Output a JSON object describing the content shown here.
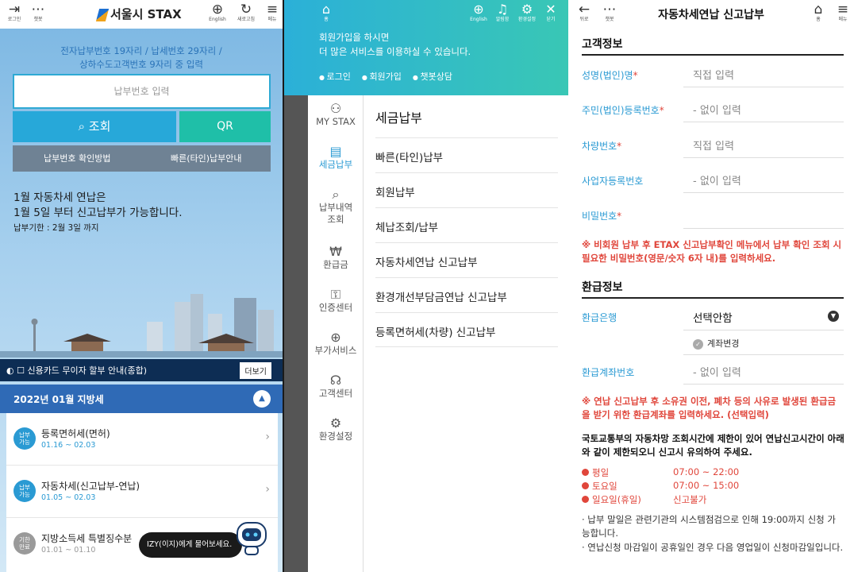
{
  "panel1": {
    "top_icons": [
      {
        "name": "login-icon",
        "glyph": "⇥",
        "label": "로그인"
      },
      {
        "name": "chatbot-icon",
        "glyph": "⋯",
        "label": "챗봇"
      },
      {
        "name": "globe-icon",
        "glyph": "⊕",
        "label": "English"
      },
      {
        "name": "refresh-icon",
        "glyph": "↻",
        "label": "새로고침"
      },
      {
        "name": "menu-icon",
        "glyph": "≡",
        "label": "메뉴"
      }
    ],
    "brand": "서울시 STAX",
    "guide_line1": "전자납부번호 19자리 / 납세번호 29자리 /",
    "guide_line2": "상하수도고객번호 9자리 중 입력",
    "pay_input_placeholder": "납부번호 입력",
    "search_label": "조회",
    "qr_label": "QR",
    "guide_btn1": "납부번호 확인방법",
    "guide_btn2": "빠른(타인)납부안내",
    "notice_line1": "1월 자동차세 연납은",
    "notice_line2": "1월 5일 부터 신고납부가 가능합니다.",
    "notice_sub": "납부기한 : 2월 3일 까지",
    "ticker_text": "◐ ☐ 신용카드 무이자 할부 안내(종합)",
    "more_label": "더보기",
    "month_label": "2022년 01월 지방세",
    "tax_items": [
      {
        "badge": "납부\n가능",
        "name": "등록면허세(면허)",
        "date": "01.16 ~ 02.03",
        "color": "#2a9ad3"
      },
      {
        "badge": "납부\n가능",
        "name": "자동차세(신고납부-연납)",
        "date": "01.05 ~ 02.03",
        "color": "#2a9ad3"
      },
      {
        "badge": "기한\n만료",
        "name": "지방소득세 특별징수분",
        "date": "01.01 ~ 01.10",
        "color": "#9a9a9a"
      }
    ],
    "bot_bubble": "IZY(이지)에게 물어보세요."
  },
  "panel2": {
    "header_icons": [
      {
        "name": "home-icon",
        "glyph": "⌂",
        "label": "홈"
      },
      {
        "name": "globe-icon",
        "glyph": "⊕",
        "label": "English"
      },
      {
        "name": "bell-icon",
        "glyph": "♫",
        "label": "알림함"
      },
      {
        "name": "gear-icon",
        "glyph": "⚙",
        "label": "환경설정"
      },
      {
        "name": "close-icon",
        "glyph": "✕",
        "label": "닫기"
      }
    ],
    "msg_line1": "회원가입을 하시면",
    "msg_line2": "더 많은 서비스를 이용하실 수 있습니다.",
    "links": [
      "로그인",
      "회원가입",
      "챗봇상담"
    ],
    "side_items": [
      {
        "name": "person-icon",
        "glyph": "⚇",
        "label": "MY STAX",
        "active": false
      },
      {
        "name": "document-icon",
        "glyph": "▤",
        "label": "세금납부",
        "active": true
      },
      {
        "name": "search-icon",
        "glyph": "⌕",
        "label": "납부내역\n조회",
        "active": false
      },
      {
        "name": "won-icon",
        "glyph": "₩",
        "label": "환급금",
        "active": false
      },
      {
        "name": "lock-icon",
        "glyph": "🔒︎",
        "label": "인증센터",
        "active": false
      },
      {
        "name": "plus-icon",
        "glyph": "⊕",
        "label": "부가서비스",
        "active": false
      },
      {
        "name": "headset-icon",
        "glyph": "☊",
        "label": "고객센터",
        "active": false
      },
      {
        "name": "gear-icon",
        "glyph": "⚙",
        "label": "환경설정",
        "active": false
      }
    ],
    "menu_title": "세금납부",
    "menu_items": [
      "빠른(타인)납부",
      "회원납부",
      "체납조회/납부",
      "자동차세연납 신고납부",
      "환경개선부담금연납 신고납부",
      "등록면허세(차량) 신고납부"
    ]
  },
  "panel3": {
    "back_label": "뒤로",
    "chatbot_label": "챗봇",
    "home_label": "홈",
    "menu_label": "메뉴",
    "title": "자동차세연납 신고납부",
    "sec1": "고객정보",
    "fields": [
      {
        "label": "성명(법인)명",
        "required": true,
        "value": "직접 입력"
      },
      {
        "label": "주민(법인)등록번호",
        "required": true,
        "value": "- 없이 입력"
      },
      {
        "label": "차량번호",
        "required": true,
        "value": "직접 입력"
      },
      {
        "label": "사업자등록번호",
        "required": false,
        "value": "- 없이 입력"
      },
      {
        "label": "비밀번호",
        "required": true,
        "value": ""
      }
    ],
    "warn1": "※ 비회원 납부 후 ETAX 신고납부확인 메뉴에서 납부 확인 조회 시 필요한 비밀번호(영문/숫자 6자 내)를 입력하세요.",
    "sec2": "환급정보",
    "bank_label": "환급은행",
    "bank_value": "선택안함",
    "acct_change": "계좌변경",
    "acct_label": "환급계좌번호",
    "acct_value": "- 없이 입력",
    "warn2": "※ 연납 신고납부 후 소유권 이전, 폐차 등의 사유로 발생된 환급금을 받기 위한 환급계좌를 입력하세요. (선택입력)",
    "limit_note": "국토교통부의 자동차망 조회시간에 제한이 있어 연납신고시간이 아래와 같이 제한되오니 신고시 유의하여 주세요.",
    "schedule": [
      {
        "day": "평일",
        "time": "07:00 ~ 22:00"
      },
      {
        "day": "토요일",
        "time": "07:00 ~ 15:00"
      },
      {
        "day": "일요일(휴일)",
        "time": "신고불가"
      }
    ],
    "bullets": [
      "· 납부 말일은 관련기관의 시스템점검으로 인해 19:00까지 신청 가능합니다.",
      "· 연납신청 마감일이 공휴일인 경우 다음 영업일이 신청마감일입니다."
    ]
  }
}
